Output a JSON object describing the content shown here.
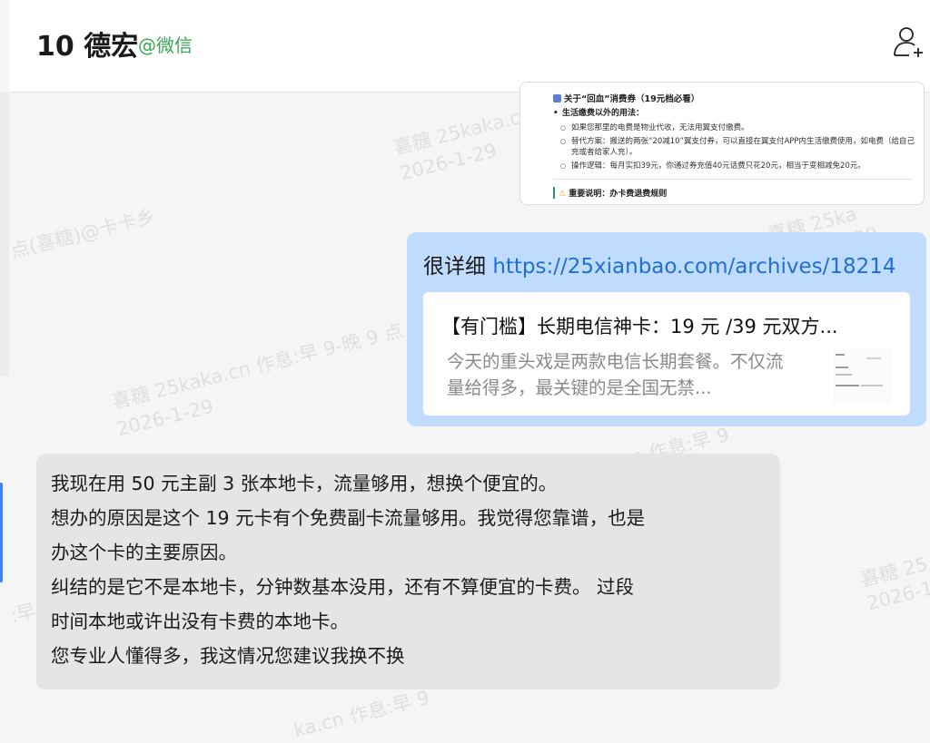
{
  "header": {
    "name": "10 德宏",
    "source": "@微信"
  },
  "screenshot": {
    "title": "关于“回血”消费券（19元档必看）",
    "bullet": "生活缴费以外的用法：",
    "items": [
      "如果您那里的电费是物业代收，无法用翼支付缴费。",
      "替代方案：搬送的两张“20减10”翼支付券，可以直接在翼支付APP内生活缴费使用，如电费（给自己充或者给家人充）。",
      "操作逻辑：每月实扣39元，你通过券充值40元话费只花20元，相当于变相减免20元。"
    ],
    "note": "重要说明：办卡费退费规则"
  },
  "outgoing": {
    "prefix": "很详细 ",
    "link": "https://25xianbao.com/archives/18214",
    "card_title": "【有门槛】长期电信神卡：19 元 /39 元双方...",
    "card_desc": "今天的重头戏是两款电信长期套餐。不仅流量给得多，最关键的是全国无禁..."
  },
  "incoming": {
    "lines": [
      "我现在用 50 元主副 3 张本地卡，流量够用，想换个便宜的。",
      "想办的原因是这个 19 元卡有个免费副卡流量够用。我觉得您靠谱，也是",
      "办这个卡的主要原因。",
      "纠结的是它不是本地卡，分钟数基本没用，还有不算便宜的卡费。 过段",
      "时间本地或许出没有卡费的本地卡。",
      "您专业人懂得多，我这情况您建议我换不换"
    ]
  },
  "watermarks": [
    "喜糖 25kaka.c",
    "2026-1-29",
    "点(喜糖)@卡卡乡",
    "喜糖 25ka",
    "2026-1-29",
    "喜糖 25kaka.cn 作息:早 9-晚 9 点",
    "2026-1-29",
    "ka.cn 作息:早 9",
    "喜糖 25",
    "2026-1",
    ":早",
    "ka.cn 作息:早 9"
  ],
  "colors": {
    "source_green": "#3aa655",
    "outgoing_bubble": "#bfdcff",
    "incoming_bubble": "#e5e5e5",
    "link": "#1f6fd6"
  },
  "icons": {
    "add_contact": "add-contact-icon"
  }
}
